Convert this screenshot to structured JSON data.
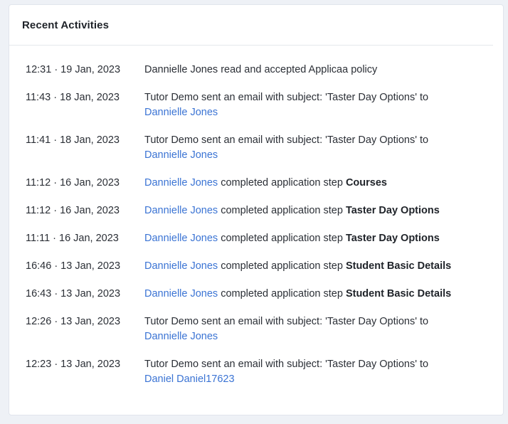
{
  "panel": {
    "title": "Recent Activities"
  },
  "activities": [
    {
      "time": "12:31 · 19 Jan, 2023",
      "text": "Dannielle Jones read and accepted Applicaa policy"
    },
    {
      "time": "11:43 · 18 Jan, 2023",
      "text": "Tutor Demo sent an email with subject: 'Taster Day Options' to",
      "link": "Dannielle Jones"
    },
    {
      "time": "11:41 · 18 Jan, 2023",
      "text": "Tutor Demo sent an email with subject: 'Taster Day Options' to",
      "link": "Dannielle Jones"
    },
    {
      "time": "11:12 · 16 Jan, 2023",
      "link": "Dannielle Jones",
      "text": " completed application step ",
      "step": "Courses"
    },
    {
      "time": "11:12 · 16 Jan, 2023",
      "link": "Dannielle Jones",
      "text": " completed application step ",
      "step": "Taster Day Options"
    },
    {
      "time": "11:11 · 16 Jan, 2023",
      "link": "Dannielle Jones",
      "text": " completed application step ",
      "step": "Taster Day Options"
    },
    {
      "time": "16:46 · 13 Jan, 2023",
      "link": "Dannielle Jones",
      "text": " completed application step ",
      "step": "Student Basic Details"
    },
    {
      "time": "16:43 · 13 Jan, 2023",
      "link": "Dannielle Jones",
      "text": " completed application step ",
      "step": "Student Basic Details"
    },
    {
      "time": "12:26 · 13 Jan, 2023",
      "text": "Tutor Demo sent an email with subject: 'Taster Day Options' to",
      "link": "Dannielle Jones"
    },
    {
      "time": "12:23 · 13 Jan, 2023",
      "text": "Tutor Demo sent an email with subject: 'Taster Day Options' to",
      "link": "Daniel Daniel17623"
    }
  ],
  "colors": {
    "link": "#3b74d4",
    "text": "#2b2f36",
    "background": "#eef1f6"
  }
}
